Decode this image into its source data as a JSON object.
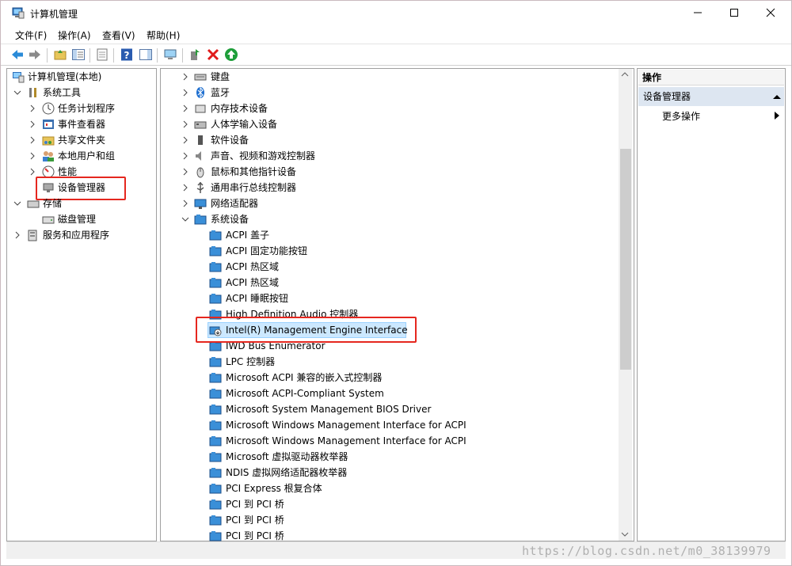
{
  "window": {
    "title": "计算机管理",
    "minimize_icon": "minimize-icon",
    "maximize_icon": "maximize-icon",
    "close_icon": "close-icon"
  },
  "menu": [
    "文件(F)",
    "操作(A)",
    "查看(V)",
    "帮助(H)"
  ],
  "left_tree": {
    "root": "计算机管理(本地)",
    "system_tools": "系统工具",
    "task_scheduler": "任务计划程序",
    "event_viewer": "事件查看器",
    "shared_folders": "共享文件夹",
    "local_users": "本地用户和组",
    "performance": "性能",
    "device_manager": "设备管理器",
    "storage": "存储",
    "disk_management": "磁盘管理",
    "services_apps": "服务和应用程序"
  },
  "device_categories": [
    "键盘",
    "蓝牙",
    "内存技术设备",
    "人体学输入设备",
    "软件设备",
    "声音、视频和游戏控制器",
    "鼠标和其他指针设备",
    "通用串行总线控制器",
    "网络适配器",
    "系统设备"
  ],
  "system_devices": [
    "ACPI 盖子",
    "ACPI 固定功能按钮",
    "ACPI 热区域",
    "ACPI 热区域",
    "ACPI 睡眠按钮",
    "High Definition Audio 控制器",
    "Intel(R) Management Engine Interface",
    "IWD Bus Enumerator",
    "LPC 控制器",
    "Microsoft ACPI 兼容的嵌入式控制器",
    "Microsoft ACPI-Compliant System",
    "Microsoft System Management BIOS Driver",
    "Microsoft Windows Management Interface for ACPI",
    "Microsoft Windows Management Interface for ACPI",
    "Microsoft 虚拟驱动器枚举器",
    "NDIS 虚拟网络适配器枚举器",
    "PCI Express 根复合体",
    "PCI 到 PCI 桥",
    "PCI 到 PCI 桥",
    "PCI 到 PCI 桥"
  ],
  "actions": {
    "header": "操作",
    "group": "设备管理器",
    "more": "更多操作"
  },
  "watermark": "https://blog.csdn.net/m0_38139979",
  "colors": {
    "highlight_box": "#e5271f",
    "selection": "#cce8ff",
    "actions_group_bg": "#dde6f1"
  }
}
